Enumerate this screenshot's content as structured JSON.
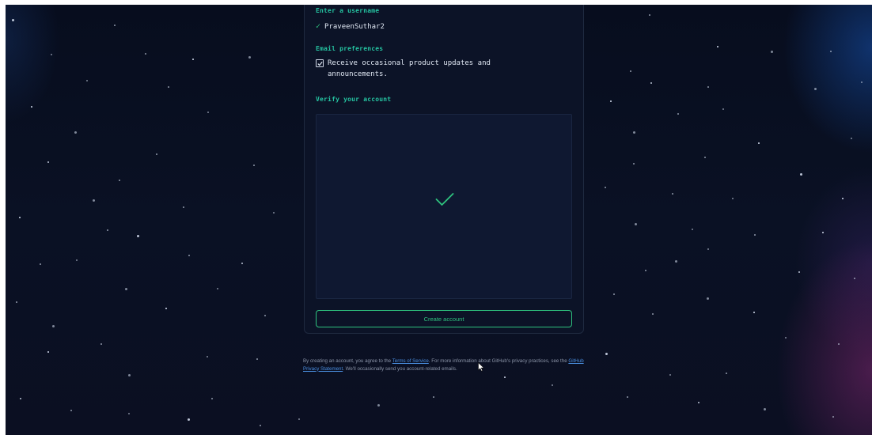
{
  "form": {
    "username_label": "Enter a username",
    "username_value": "PraveenSuthar2",
    "email_pref_label": "Email preferences",
    "email_pref_checkbox_label": "Receive occasional product updates and announcements.",
    "email_pref_checked": true,
    "verify_label": "Verify your account",
    "verify_status_icon": "checkmark-icon",
    "create_button_label": "Create account"
  },
  "footer": {
    "text_1": "By creating an account, you agree to the ",
    "terms_link": "Terms of Service",
    "text_2": ". For more information about GitHub's privacy practices, see the ",
    "privacy_link": "GitHub Privacy Statement",
    "text_3": ". We'll occasionally send you account-related emails."
  },
  "colors": {
    "accent_teal": "#25c2a0",
    "success_green": "#2ec27e",
    "link_blue": "#4a8fe0",
    "background": "#0a1124"
  }
}
